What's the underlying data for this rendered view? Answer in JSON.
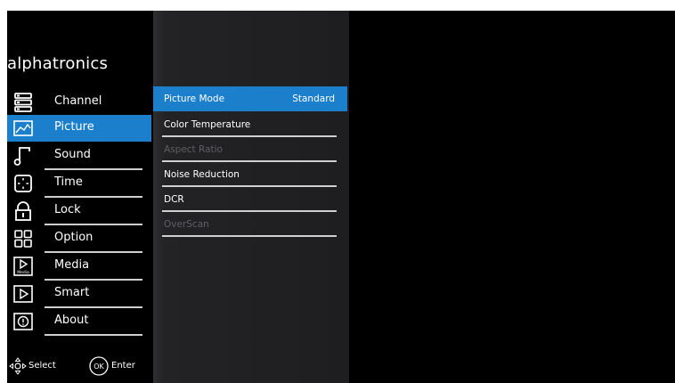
{
  "brand": "alphatronics",
  "colors": {
    "accent": "#1b7fcc",
    "background": "#000000",
    "disabled": "#5f5f63"
  },
  "menu": {
    "items": [
      {
        "label": "Channel",
        "icon": "channel-list-icon"
      },
      {
        "label": "Picture",
        "icon": "picture-icon",
        "selected": true
      },
      {
        "label": "Sound",
        "icon": "music-note-icon"
      },
      {
        "label": "Time",
        "icon": "time-icon"
      },
      {
        "label": "Lock",
        "icon": "lock-icon"
      },
      {
        "label": "Option",
        "icon": "option-grid-icon"
      },
      {
        "label": "Media",
        "icon": "media-play-icon"
      },
      {
        "label": "Smart",
        "icon": "smart-play-icon"
      },
      {
        "label": "About",
        "icon": "info-icon"
      }
    ]
  },
  "submenu": {
    "items": [
      {
        "label": "Picture Mode",
        "value": "Standard",
        "selected": true
      },
      {
        "label": "Color Temperature",
        "value": ""
      },
      {
        "label": "Aspect Ratio",
        "value": "",
        "disabled": true
      },
      {
        "label": "Noise Reduction",
        "value": ""
      },
      {
        "label": "DCR",
        "value": ""
      },
      {
        "label": "OverScan",
        "value": "",
        "disabled": true
      }
    ]
  },
  "hints": {
    "select": "Select",
    "ok": "OK",
    "enter": "Enter",
    "media_icon_text": "Media"
  }
}
